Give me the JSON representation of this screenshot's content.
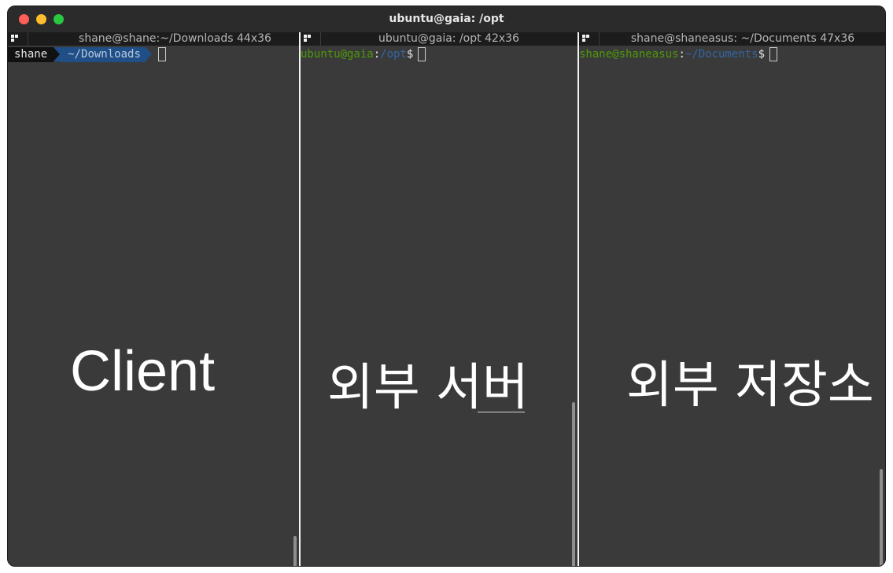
{
  "window": {
    "title": "ubuntu@gaia: /opt"
  },
  "panes": [
    {
      "header": "shane@shane:~/Downloads 44x36",
      "prompt_user": "shane",
      "prompt_path": "~/Downloads",
      "label": "Client"
    },
    {
      "header": "ubuntu@gaia: /opt 42x36",
      "prompt_user": "ubuntu@gaia",
      "prompt_sep": ":",
      "prompt_path": "/opt",
      "prompt_suffix": "$",
      "label": "외부 서버"
    },
    {
      "header": "shane@shaneasus: ~/Documents 47x36",
      "prompt_user": "shane@shaneasus",
      "prompt_sep": ":",
      "prompt_path": "~/Documents",
      "prompt_suffix": "$",
      "label": "외부 저장소"
    }
  ],
  "colors": {
    "prompt_green": "#4e9a06",
    "prompt_blue": "#3465a4",
    "terminal_bg": "#3a3a3a",
    "close": "#ff5f57",
    "minimize": "#febc2e",
    "maximize": "#28c840"
  }
}
